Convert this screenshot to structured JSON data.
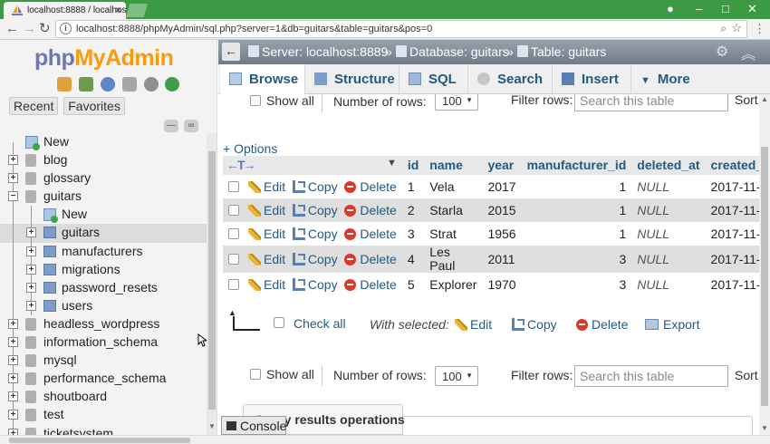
{
  "browser": {
    "tab_title": "localhost:8888 / localhos",
    "url": "localhost:8888/phpMyAdmin/sql.php?server=1&db=guitars&table=guitars&pos=0"
  },
  "sidebar": {
    "logo": {
      "php": "php",
      "my": "My",
      "admin": "Admin"
    },
    "tabs": [
      "Recent",
      "Favorites"
    ],
    "tree": [
      {
        "label": "New",
        "kind": "new",
        "level": 0
      },
      {
        "label": "blog",
        "kind": "db",
        "level": 0
      },
      {
        "label": "glossary",
        "kind": "db",
        "level": 0
      },
      {
        "label": "guitars",
        "kind": "db-open",
        "level": 0
      },
      {
        "label": "New",
        "kind": "new",
        "level": 1
      },
      {
        "label": "guitars",
        "kind": "table",
        "level": 1,
        "selected": true
      },
      {
        "label": "manufacturers",
        "kind": "table",
        "level": 1
      },
      {
        "label": "migrations",
        "kind": "table",
        "level": 1
      },
      {
        "label": "password_resets",
        "kind": "table",
        "level": 1
      },
      {
        "label": "users",
        "kind": "table",
        "level": 1
      },
      {
        "label": "headless_wordpress",
        "kind": "db",
        "level": 0
      },
      {
        "label": "information_schema",
        "kind": "db",
        "level": 0
      },
      {
        "label": "mysql",
        "kind": "db",
        "level": 0
      },
      {
        "label": "performance_schema",
        "kind": "db",
        "level": 0
      },
      {
        "label": "shoutboard",
        "kind": "db",
        "level": 0
      },
      {
        "label": "test",
        "kind": "db",
        "level": 0
      },
      {
        "label": "ticketsystem",
        "kind": "db",
        "level": 0
      }
    ]
  },
  "breadcrumb": {
    "server": "Server: localhost:8889",
    "database": "Database: guitars",
    "table": "Table: guitars",
    "sep": "»"
  },
  "menu": {
    "browse": "Browse",
    "structure": "Structure",
    "sql": "SQL",
    "search": "Search",
    "insert": "Insert",
    "more": "More"
  },
  "controls": {
    "show_all": "Show all",
    "number_of_rows": "Number of rows:",
    "rows_value": "100",
    "filter_rows": "Filter rows:",
    "filter_placeholder": "Search this table",
    "sort": "Sort"
  },
  "options_link": "+ Options",
  "table": {
    "arrows": "←T→",
    "columns": [
      "id",
      "name",
      "year",
      "manufacturer_id",
      "deleted_at",
      "created_"
    ],
    "actions": {
      "edit": "Edit",
      "copy": "Copy",
      "delete": "Delete"
    },
    "rows": [
      {
        "id": "1",
        "name": "Vela",
        "year": "2017",
        "manufacturer_id": "1",
        "deleted_at": "NULL",
        "created": "2017-11-"
      },
      {
        "id": "2",
        "name": "Starla",
        "year": "2015",
        "manufacturer_id": "1",
        "deleted_at": "NULL",
        "created": "2017-11-"
      },
      {
        "id": "3",
        "name": "Strat",
        "year": "1956",
        "manufacturer_id": "1",
        "deleted_at": "NULL",
        "created": "2017-11-"
      },
      {
        "id": "4",
        "name": "Les Paul",
        "year": "2011",
        "manufacturer_id": "3",
        "deleted_at": "NULL",
        "created": "2017-11-"
      },
      {
        "id": "5",
        "name": "Explorer",
        "year": "1970",
        "manufacturer_id": "3",
        "deleted_at": "NULL",
        "created": "2017-11-"
      }
    ]
  },
  "bulk": {
    "check_all": "Check all",
    "with_selected": "With selected:",
    "edit": "Edit",
    "copy": "Copy",
    "delete": "Delete",
    "export": "Export"
  },
  "query_results_operations": "Query results operations",
  "console": "Console"
}
